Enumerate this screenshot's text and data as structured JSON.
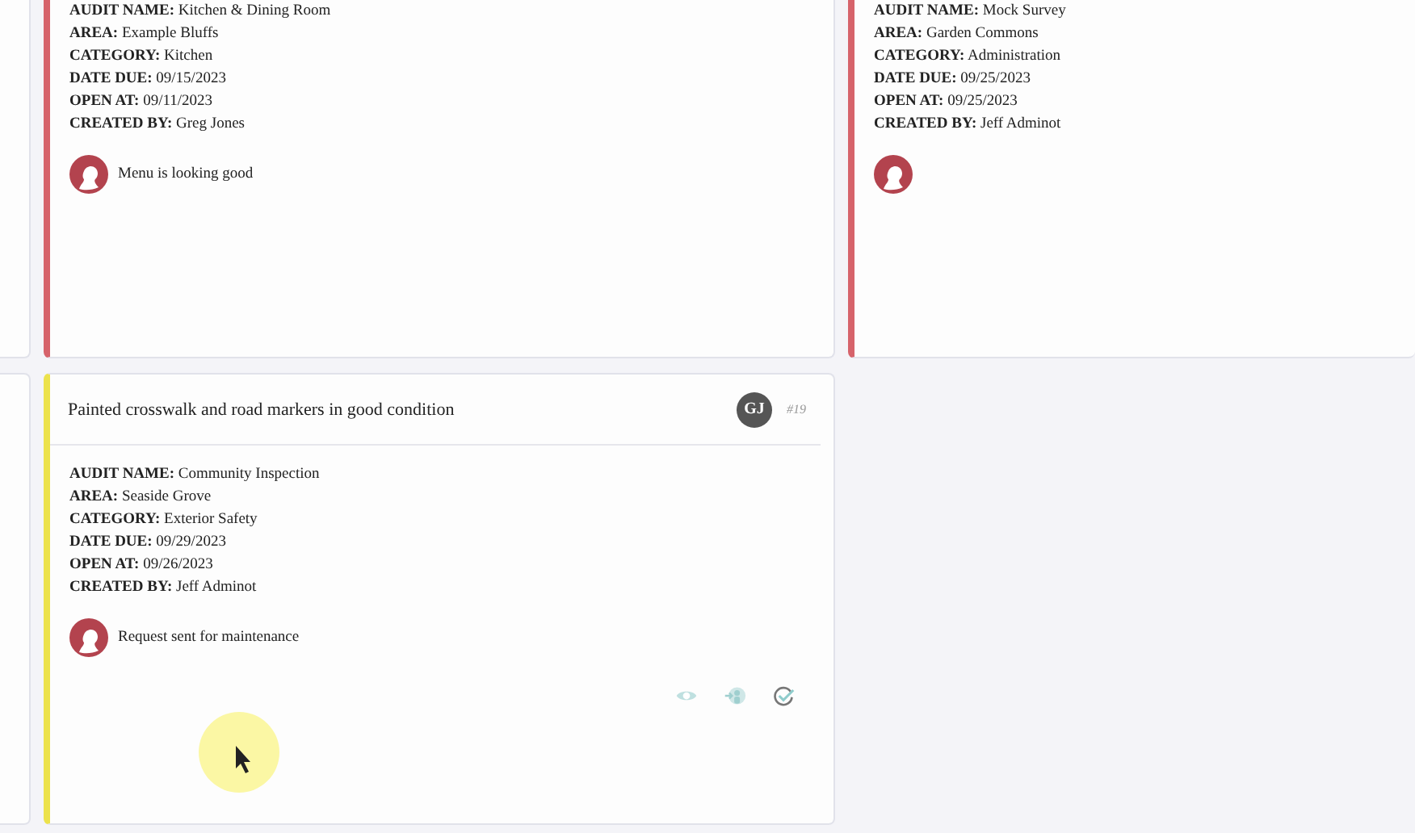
{
  "cards": [
    {
      "color": "#d6636b",
      "fields": [
        {
          "label": "AUDIT NAME:",
          "value": "Kitchen & Dining Room"
        },
        {
          "label": "AREA:",
          "value": "Example Bluffs"
        },
        {
          "label": "CATEGORY:",
          "value": "Kitchen"
        },
        {
          "label": "DATE DUE:",
          "value": "09/15/2023"
        },
        {
          "label": "OPEN AT:",
          "value": "09/11/2023"
        },
        {
          "label": "CREATED BY:",
          "value": "Greg Jones"
        }
      ],
      "comment": "Menu is looking good"
    },
    {
      "color": "#d6636b",
      "fields": [
        {
          "label": "AUDIT NAME:",
          "value": "Mock Survey"
        },
        {
          "label": "AREA:",
          "value": "Garden Commons"
        },
        {
          "label": "CATEGORY:",
          "value": "Administration"
        },
        {
          "label": "DATE DUE:",
          "value": "09/25/2023"
        },
        {
          "label": "OPEN AT:",
          "value": "09/25/2023"
        },
        {
          "label": "CREATED BY:",
          "value": "Jeff Adminot"
        }
      ]
    },
    {
      "color": "#ece24c",
      "title": "Painted crosswalk and road markers in good condition",
      "assignee": "GJ",
      "number": "#19",
      "fields": [
        {
          "label": "AUDIT NAME:",
          "value": "Community Inspection"
        },
        {
          "label": "AREA:",
          "value": "Seaside Grove"
        },
        {
          "label": "CATEGORY:",
          "value": "Exterior Safety"
        },
        {
          "label": "DATE DUE:",
          "value": "09/29/2023"
        },
        {
          "label": "OPEN AT:",
          "value": "09/26/2023"
        },
        {
          "label": "CREATED BY:",
          "value": "Jeff Adminot"
        }
      ],
      "comment": "Request sent for maintenance",
      "actions": [
        {
          "kind": "view"
        },
        {
          "kind": "assign"
        },
        {
          "kind": "complete"
        }
      ]
    }
  ]
}
